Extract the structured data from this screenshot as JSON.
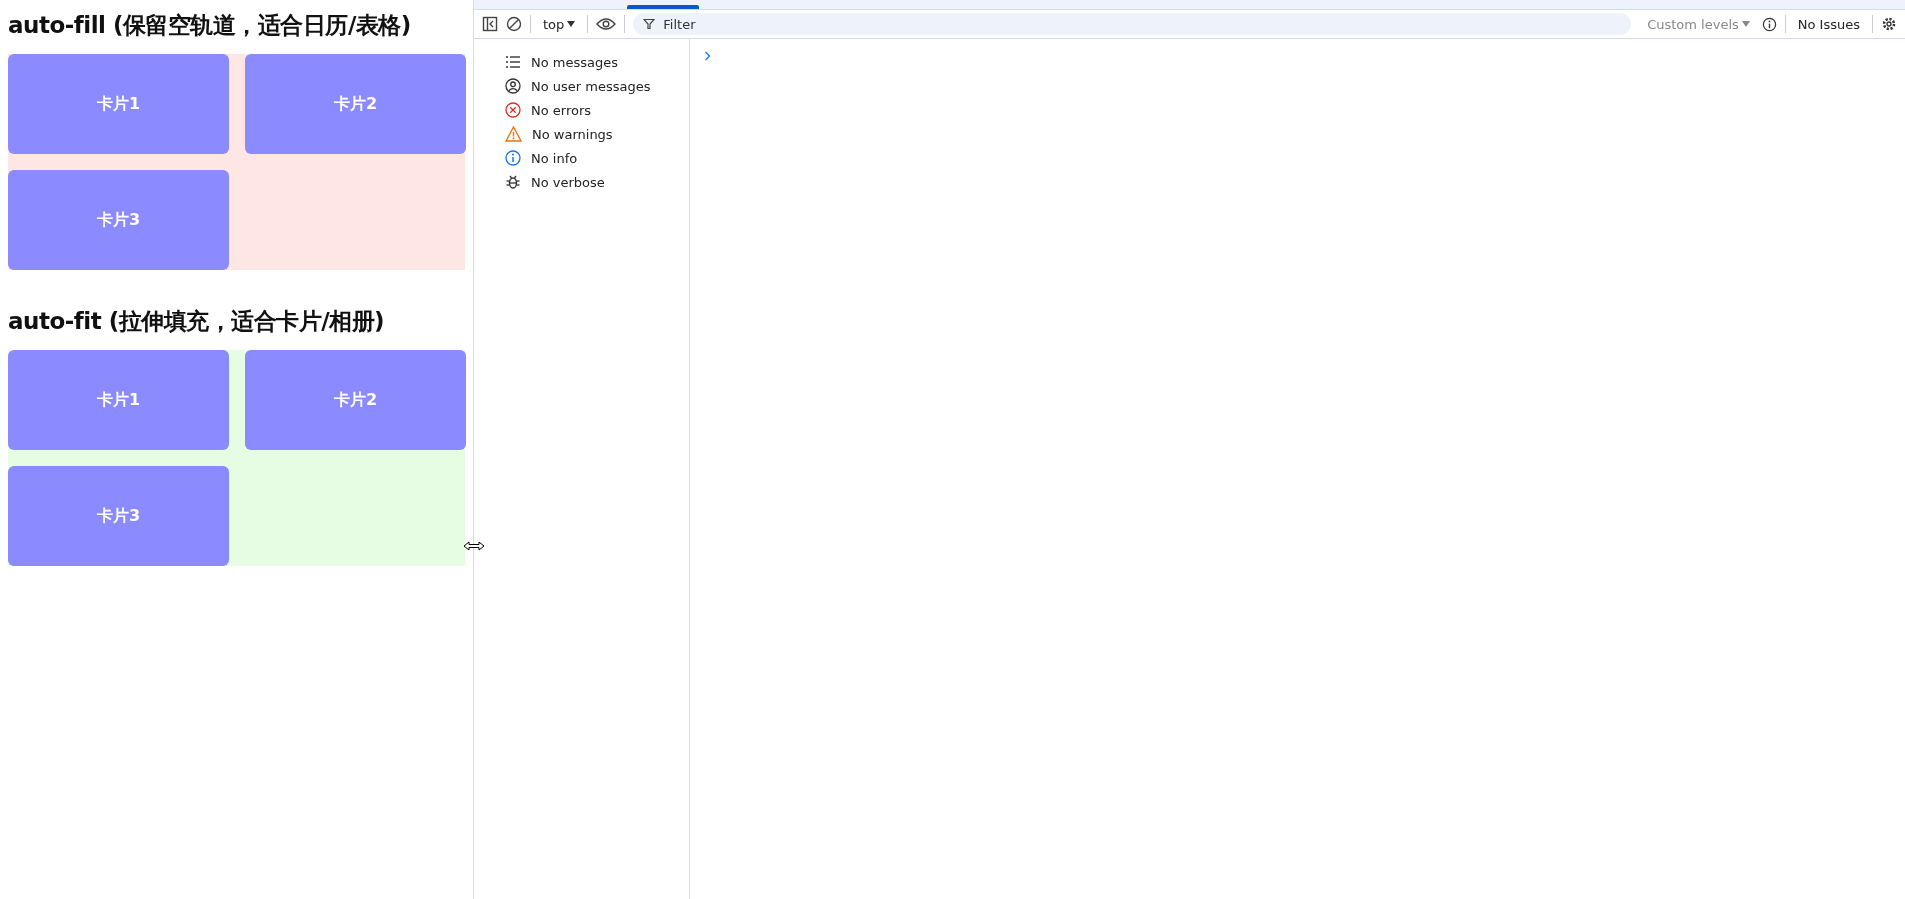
{
  "sections": [
    {
      "kind": "fill",
      "title": "auto-fill (保留空轨道，适合日历/表格)",
      "cards": [
        "卡片1",
        "卡片2",
        "卡片3"
      ]
    },
    {
      "kind": "fit",
      "title": "auto-fit (拉伸填充，适合卡片/相册)",
      "cards": [
        "卡片1",
        "卡片2",
        "卡片3"
      ]
    }
  ],
  "devtools": {
    "context": "top",
    "filter": {
      "placeholder": "Filter"
    },
    "levels": "Custom levels",
    "issues": "No Issues",
    "sidebar": [
      {
        "kind": "list",
        "label": "No messages"
      },
      {
        "kind": "user",
        "label": "No user messages"
      },
      {
        "kind": "error",
        "label": "No errors"
      },
      {
        "kind": "warning",
        "label": "No warnings"
      },
      {
        "kind": "info",
        "label": "No info"
      },
      {
        "kind": "verbose",
        "label": "No verbose"
      }
    ]
  }
}
